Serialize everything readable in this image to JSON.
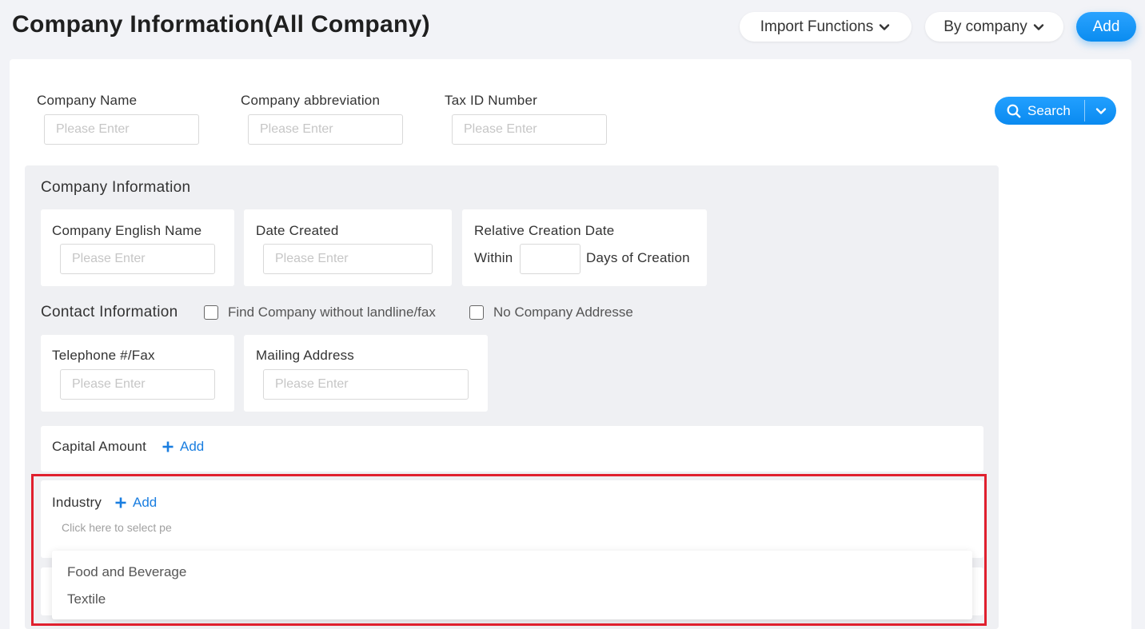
{
  "header": {
    "title": "Company Information(All Company)",
    "import_label": "Import Functions",
    "bycompany_label": "By company",
    "add_label": "Add"
  },
  "filters": {
    "company_name_label": "Company Name",
    "abbreviation_label": "Company abbreviation",
    "tax_id_label": "Tax ID Number",
    "placeholder": "Please Enter",
    "search_label": "Search"
  },
  "company_info": {
    "title": "Company Information",
    "english_name_label": "Company English Name",
    "date_created_label": "Date Created",
    "relative_date_label": "Relative Creation Date",
    "within_label": "Within",
    "days_label": "Days of Creation"
  },
  "contact_info": {
    "title": "Contact Information",
    "no_landline_label": "Find Company without landline/fax",
    "no_address_label": "No Company Addresse",
    "telephone_label": "Telephone #/Fax",
    "mailing_label": "Mailing Address"
  },
  "capital": {
    "label": "Capital Amount",
    "add_label": "Add"
  },
  "industry": {
    "label": "Industry",
    "add_label": "Add",
    "select_placeholder": "Click here to select pe",
    "options": [
      "Food and Beverage",
      "Textile"
    ]
  },
  "colors": {
    "accent": "#0a8cf0",
    "link": "#1a7ee0",
    "highlight": "#e0202e"
  }
}
